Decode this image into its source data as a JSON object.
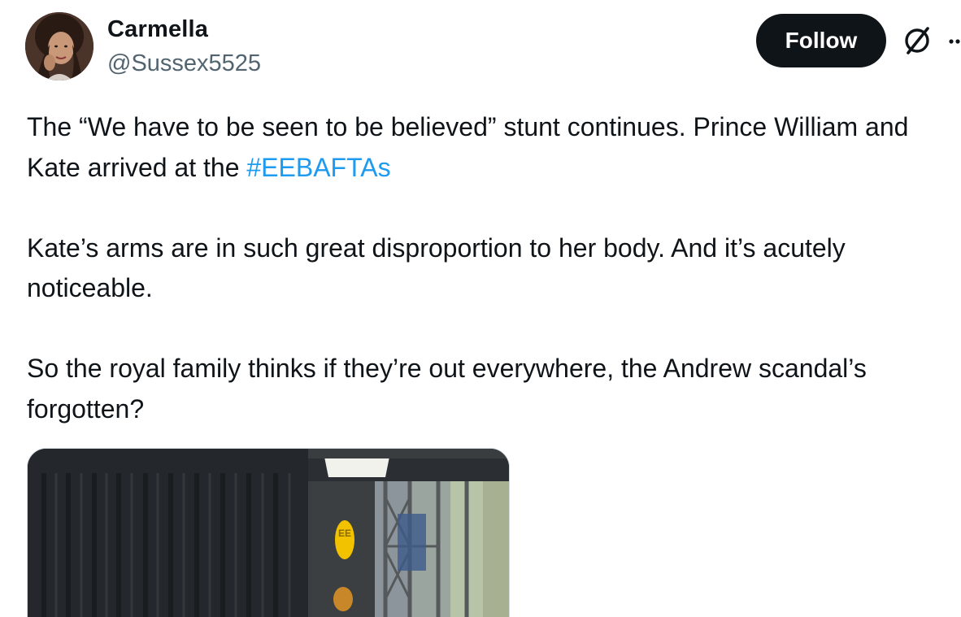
{
  "post": {
    "author": {
      "name": "Carmella",
      "handle": "@Sussex5525",
      "avatar_icon": "avatar"
    },
    "actions": {
      "follow_label": "Follow",
      "grok_icon": "grok-icon",
      "more_icon": "more-icon"
    },
    "text": {
      "p1_before": "The “We have to be seen to be believed” stunt continues. Prince William and Kate arrived at the ",
      "p1_hashtag": "#EEBAFTAs",
      "p2": "Kate’s arms are in such great disproportion to her body. And it’s acutely noticeable.",
      "p3": "So the royal family thinks if they’re out everywhere, the Andrew scandal’s forgotten?"
    },
    "media": {
      "sign_text": "EE",
      "icon": "photo"
    }
  },
  "colors": {
    "text": "#0f1419",
    "secondary": "#536471",
    "link": "#1d9bf0",
    "follow_bg": "#0f1419",
    "follow_text": "#ffffff"
  }
}
